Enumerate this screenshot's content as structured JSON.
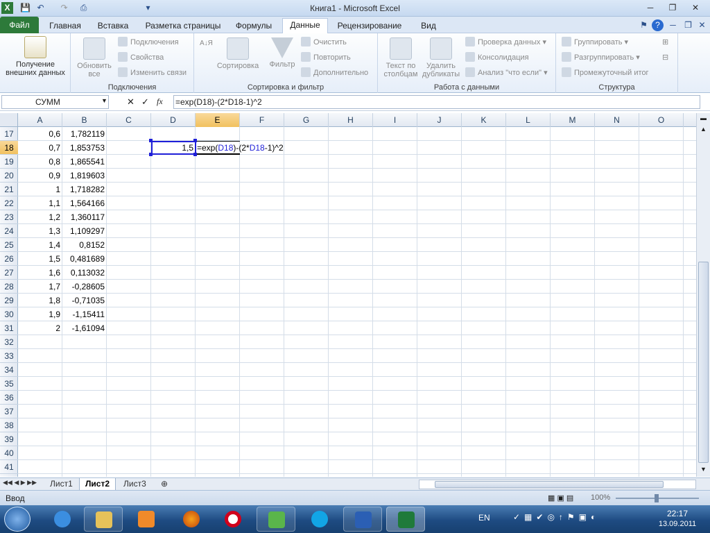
{
  "window": {
    "title": "Книга1 - Microsoft Excel",
    "minimize": "─",
    "maximize": "❐",
    "close": "✕"
  },
  "qat": {
    "save": "💾",
    "undo": "↶",
    "redo": "↷",
    "print_preview": "⎙",
    "customize": "▾"
  },
  "tabs": [
    "Файл",
    "Главная",
    "Вставка",
    "Разметка страницы",
    "Формулы",
    "Данные",
    "Рецензирование",
    "Вид"
  ],
  "active_tab": "Данные",
  "ribbon": {
    "get_external": "Получение внешних данных",
    "refresh_all": "Обновить все",
    "connections": "Подключения",
    "properties": "Свойства",
    "edit_links": "Изменить связи",
    "group_connections": "Подключения",
    "sort_az": "А↓Я",
    "sort": "Сортировка",
    "filter": "Фильтр",
    "clear": "Очистить",
    "reapply": "Повторить",
    "advanced": "Дополнительно",
    "group_sort": "Сортировка и фильтр",
    "text_to_columns": "Текст по столбцам",
    "remove_duplicates": "Удалить дубликаты",
    "data_validation": "Проверка данных",
    "consolidate": "Консолидация",
    "what_if": "Анализ \"что если\"",
    "group_data_tools": "Работа с данными",
    "group": "Группировать",
    "ungroup": "Разгруппировать",
    "subtotal": "Промежуточный итог",
    "group_outline": "Структура"
  },
  "formula_bar": {
    "name_box": "СУММ",
    "fx": "fx",
    "cancel": "✕",
    "enter": "✓",
    "formula": "=exp(D18)-(2*D18-1)^2"
  },
  "columns": [
    "A",
    "B",
    "C",
    "D",
    "E",
    "F",
    "G",
    "H",
    "I",
    "J",
    "K",
    "L",
    "M",
    "N",
    "O"
  ],
  "rows": [
    "17",
    "18",
    "19",
    "20",
    "21",
    "22",
    "23",
    "24",
    "25",
    "26",
    "27",
    "28",
    "29",
    "30",
    "31",
    "32",
    "33",
    "34",
    "35",
    "36",
    "37",
    "38",
    "39",
    "40",
    "41"
  ],
  "colA": [
    "0,6",
    "0,7",
    "0,8",
    "0,9",
    "1",
    "1,1",
    "1,2",
    "1,3",
    "1,4",
    "1,5",
    "1,6",
    "1,7",
    "1,8",
    "1,9",
    "2"
  ],
  "colB": [
    "1,782119",
    "1,853753",
    "1,865541",
    "1,819603",
    "1,718282",
    "1,564166",
    "1,360117",
    "1,109297",
    "0,8152",
    "0,481689",
    "0,113032",
    "-0,28605",
    "-0,71035",
    "-1,15411",
    "-1,61094"
  ],
  "cellD18": "1,5",
  "edit_formula": {
    "p1": "=exp(",
    "p2": "D18",
    "p3": ")-(2*",
    "p4": "D18",
    "p5": "-1)^2"
  },
  "sheets": [
    "Лист1",
    "Лист2",
    "Лист3"
  ],
  "active_sheet": "Лист2",
  "status": {
    "mode": "Ввод",
    "zoom": "100%"
  },
  "taskbar": {
    "lang": "EN",
    "time": "22:17",
    "date": "13.09.2011"
  }
}
